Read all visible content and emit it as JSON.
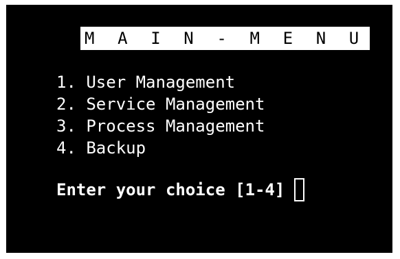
{
  "window": {
    "background": "#000000",
    "foreground": "#ffffff"
  },
  "title": "M A I N - M E N U",
  "menu": {
    "items": [
      {
        "label": "1. User Management"
      },
      {
        "label": "2. Service Management"
      },
      {
        "label": "3. Process Management"
      },
      {
        "label": "4. Backup"
      }
    ]
  },
  "prompt": {
    "text": "Enter your choice [1-4]",
    "input_value": ""
  }
}
